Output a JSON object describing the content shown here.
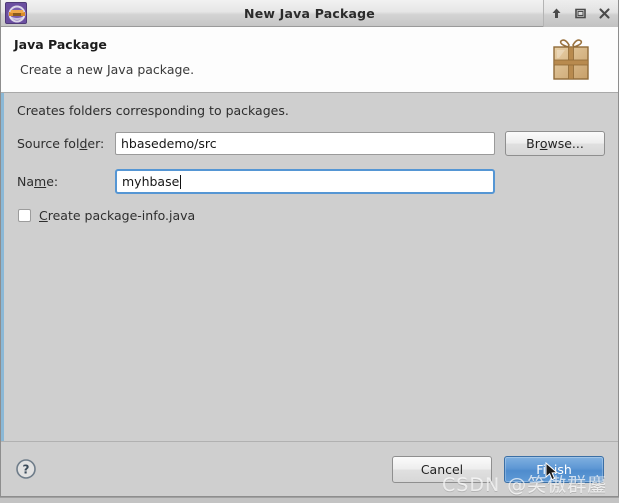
{
  "window": {
    "title": "New Java Package",
    "app_icon": "eclipse-java-icon",
    "controls": {
      "minimize_label": "▲",
      "maximize_label": "□",
      "close_label": "✕",
      "minimize_icon": "arrow-up-icon",
      "maximize_icon": "maximize-icon",
      "close_icon": "close-icon"
    }
  },
  "header": {
    "title": "Java Package",
    "description": "Create a new Java package.",
    "banner_icon": "package-gift-box-icon"
  },
  "body": {
    "note": "Creates folders corresponding to packages.",
    "source_folder": {
      "label_pre": "Source fol",
      "label_mnemonic": "d",
      "label_post": "er:",
      "value": "hbasedemo/src",
      "placeholder": ""
    },
    "browse_button": {
      "label_pre": "Br",
      "label_mnemonic": "o",
      "label_post": "wse..."
    },
    "name_field": {
      "label_pre": "Na",
      "label_mnemonic": "m",
      "label_post": "e:",
      "value": "myhbase",
      "placeholder": ""
    },
    "create_package_info": {
      "label_mnemonic": "C",
      "label_post": "reate package-info.java",
      "checked": false
    }
  },
  "footer": {
    "help_label": "?",
    "help_icon": "question-mark-icon",
    "cancel_label": "Cancel",
    "finish_label": "Finish"
  },
  "watermark": {
    "text": "CSDN @笑傲群鏖"
  },
  "colors": {
    "accent_blue": "#5596d4",
    "default_button_blue": "#5e97d4",
    "body_bg": "#cfcfcf",
    "header_bg": "#fdfdfd",
    "left_accent": "#8bb8d6"
  }
}
